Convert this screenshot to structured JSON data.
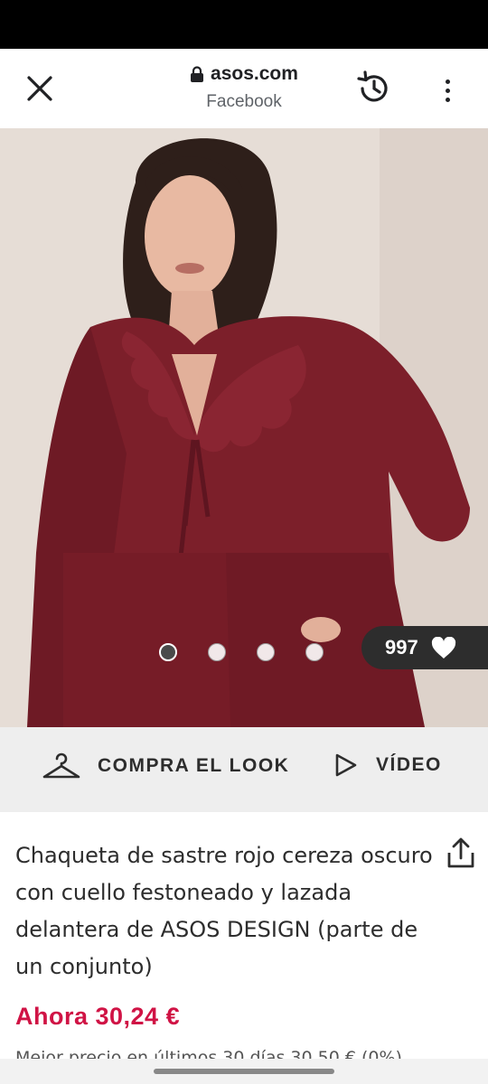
{
  "browser": {
    "url": "asos.com",
    "referrer": "Facebook",
    "icons": [
      "close-icon",
      "lock-icon",
      "history-icon",
      "more-vert-icon"
    ]
  },
  "gallery": {
    "image_count": 4,
    "active_index": 0,
    "likes": "997"
  },
  "look_bar": {
    "shop_look_label": "COMPRA EL LOOK",
    "video_label": "VÍDEO"
  },
  "product": {
    "title": "Chaqueta de sastre rojo cereza oscuro con cuello festoneado y lazada delantera de ASOS DESIGN (parte de un conjunto)",
    "price": "Ahora 30,24 €",
    "price_note": "Mejor precio en últimos 30 días 30,50 € (0%)"
  },
  "colors": {
    "price": "#d01345",
    "garment": "#7c1f2a",
    "background": "#e6ddd6"
  }
}
